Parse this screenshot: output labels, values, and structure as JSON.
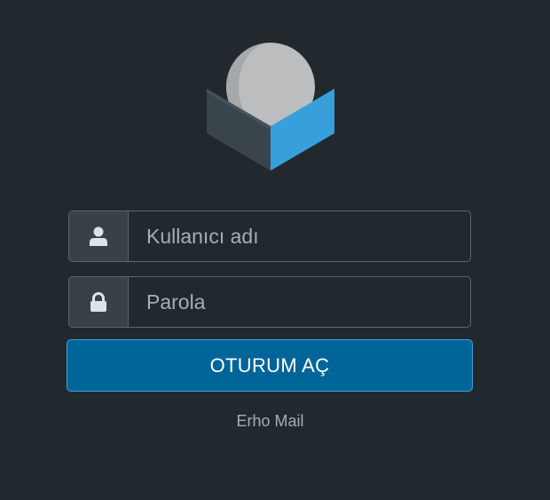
{
  "login": {
    "username_placeholder": "Kullanıcı adı",
    "username_value": "",
    "password_placeholder": "Parola",
    "password_value": "",
    "submit_label": "OTURUM AÇ"
  },
  "footer": {
    "product_name": "Erho Mail"
  },
  "icons": {
    "logo": "roundcube-logo",
    "username": "user-icon",
    "password": "lock-icon"
  },
  "colors": {
    "background": "#21292e",
    "accent": "#006599",
    "accent_border": "#3aa5dd"
  }
}
